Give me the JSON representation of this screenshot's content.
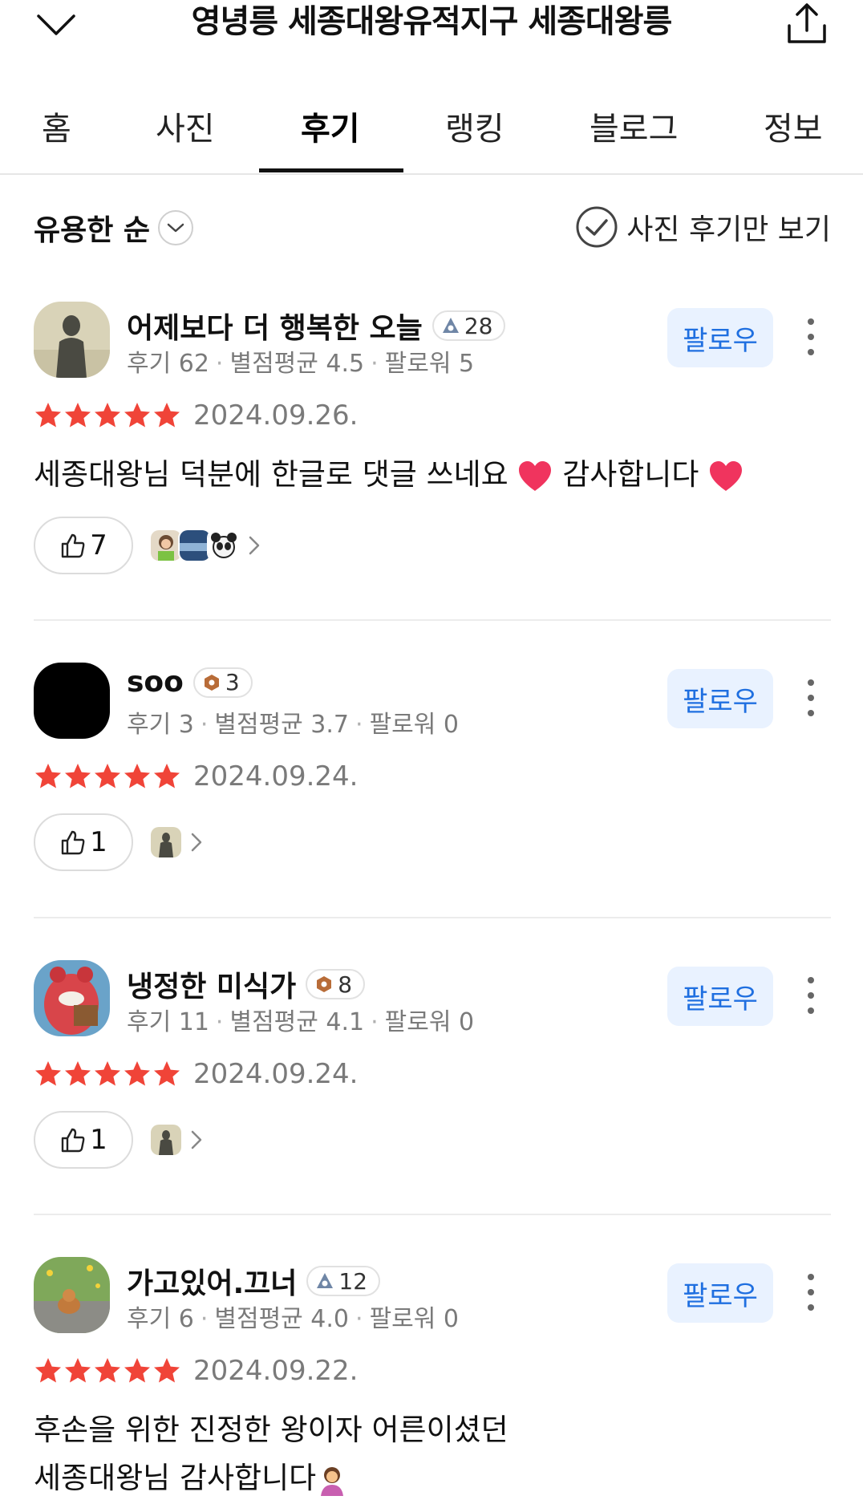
{
  "header": {
    "title": "영녕릉 세종대왕유적지구 세종대왕릉",
    "back_icon": "chevron-down-icon",
    "share_icon": "share-icon"
  },
  "tabs": [
    {
      "label": "홈"
    },
    {
      "label": "사진"
    },
    {
      "label": "후기",
      "active": true
    },
    {
      "label": "랭킹"
    },
    {
      "label": "블로그"
    },
    {
      "label": "정보"
    }
  ],
  "toolbar": {
    "sort_label": "유용한 순",
    "photo_filter_label": "사진 후기만 보기"
  },
  "follow_label": "팔로우",
  "colors": {
    "star": "#f04438",
    "follow_text": "#1f6fe0",
    "follow_bg": "#e9f2ff"
  },
  "reviews": [
    {
      "name": "어제보다 더 행복한 오늘",
      "level": "28",
      "stats": [
        "후기 62",
        "별점평균 4.5",
        "팔로워 5"
      ],
      "rating": 5,
      "date": "2024.09.26.",
      "text": [
        "세종대왕님 덕분에 한글로 댓글 쓰네요",
        "감사합니다"
      ],
      "likes": "7"
    },
    {
      "name": "soo",
      "level": "3",
      "stats": [
        "후기 3",
        "별점평균 3.7",
        "팔로워 0"
      ],
      "rating": 5,
      "date": "2024.09.24.",
      "likes": "1"
    },
    {
      "name": "냉정한 미식가",
      "level": "8",
      "stats": [
        "후기 11",
        "별점평균 4.1",
        "팔로워 0"
      ],
      "rating": 5,
      "date": "2024.09.24.",
      "likes": "1"
    },
    {
      "name": "가고있어.끄너",
      "level": "12",
      "stats": [
        "후기 6",
        "별점평균 4.0",
        "팔로워 0"
      ],
      "rating": 5,
      "date": "2024.09.22.",
      "text": [
        "후손을 위한 진정한 왕이자 어른이셨던",
        "세종대왕님 감사합니다"
      ]
    }
  ]
}
